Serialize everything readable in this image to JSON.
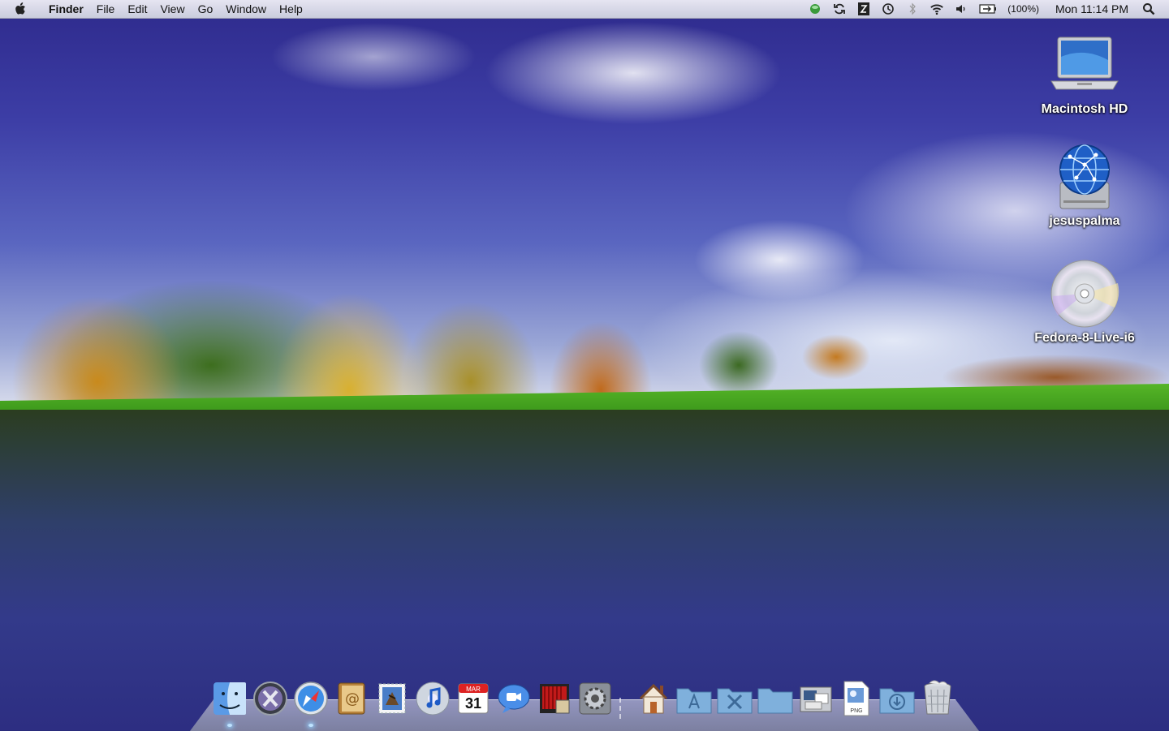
{
  "menubar": {
    "app_name": "Finder",
    "menus": [
      "File",
      "Edit",
      "View",
      "Go",
      "Window",
      "Help"
    ],
    "battery_percent": "(100%)",
    "clock": "Mon 11:14 PM",
    "icons": [
      "status-indicator-icon",
      "sync-icon",
      "input-menu-icon",
      "time-machine-icon",
      "bluetooth-icon",
      "wifi-icon",
      "volume-icon",
      "battery-icon",
      "spotlight-icon"
    ]
  },
  "desktop": {
    "icons": [
      {
        "label": "Macintosh HD",
        "icon": "laptop-drive-icon"
      },
      {
        "label": "jesuspalma",
        "icon": "network-drive-icon"
      },
      {
        "label": "Fedora-8-Live-i6",
        "icon": "cd-disc-icon"
      }
    ]
  },
  "dock": {
    "calendar_month": "MAR",
    "calendar_day": "31",
    "png_label": "PNG",
    "apps": [
      {
        "name": "Finder",
        "icon": "finder-icon",
        "running": true
      },
      {
        "name": "Mac OS X",
        "icon": "mac-os-x-icon",
        "running": false
      },
      {
        "name": "Safari",
        "icon": "safari-icon",
        "running": true
      },
      {
        "name": "Address Book",
        "icon": "address-book-icon",
        "running": false
      },
      {
        "name": "Mail",
        "icon": "mail-stamp-icon",
        "running": false
      },
      {
        "name": "iTunes",
        "icon": "itunes-icon",
        "running": false
      },
      {
        "name": "iCal",
        "icon": "ical-icon",
        "running": false
      },
      {
        "name": "iChat",
        "icon": "ichat-icon",
        "running": false
      },
      {
        "name": "Front Row",
        "icon": "front-row-icon",
        "running": false
      },
      {
        "name": "System Preferences",
        "icon": "system-preferences-icon",
        "running": false
      }
    ],
    "stacks": [
      {
        "name": "Home",
        "icon": "home-icon"
      },
      {
        "name": "Applications",
        "icon": "applications-folder-icon"
      },
      {
        "name": "Utilities",
        "icon": "utilities-folder-icon"
      },
      {
        "name": "Folder",
        "icon": "folder-icon"
      },
      {
        "name": "Work",
        "icon": "work-stack-icon"
      },
      {
        "name": "PNG",
        "icon": "png-file-icon"
      },
      {
        "name": "Downloads",
        "icon": "downloads-folder-icon"
      },
      {
        "name": "Trash",
        "icon": "trash-icon"
      }
    ]
  },
  "colors": {
    "menubar_bg": "#e6e8ef",
    "folder_blue": "#7fb0dc",
    "label_text": "#ffffff"
  }
}
